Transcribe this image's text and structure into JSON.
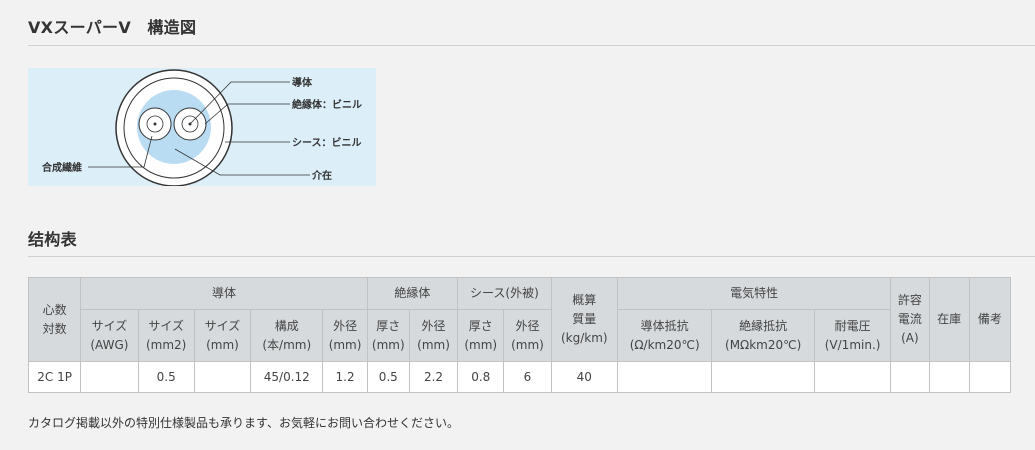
{
  "diagram_section": {
    "title": "VXスーパーV　構造図"
  },
  "diagram": {
    "labels": {
      "conductor": "導体",
      "insulation": "絶縁体：ビニル",
      "sheath": "シース：ビニル",
      "filler": "介在",
      "synthetic_fiber": "合成繊維"
    }
  },
  "table_section": {
    "title": "结构表"
  },
  "table": {
    "headers": {
      "cores": "心数\n対数",
      "conductor": "導体",
      "insulation": "絶縁体",
      "sheath": "シース(外被)",
      "weight": "概算\n質量\n(kg/km)",
      "electrical": "電気特性",
      "current": "許容\n電流\n(A)",
      "stock": "在庫",
      "remarks": "備考",
      "size_awg": "サイズ\n(AWG)",
      "size_mm2": "サイズ\n(mm2)",
      "size_mm": "サイズ\n(mm)",
      "composition": "構成\n(本/mm)",
      "cond_od": "外径\n(mm)",
      "ins_thickness": "厚さ\n(mm)",
      "ins_od": "外径\n(mm)",
      "sheath_thickness": "厚さ\n(mm)",
      "sheath_od": "外径\n(mm)",
      "cond_resistance": "導体抵抗\n(Ω/km20℃)",
      "ins_resistance": "絶縁抵抗\n(MΩkm20℃)",
      "withstand_voltage": "耐電圧\n(V/1min.)"
    },
    "rows": [
      {
        "cores": "2C 1P",
        "size_awg": "",
        "size_mm2": "0.5",
        "size_mm": "",
        "composition": "45/0.12",
        "cond_od": "1.2",
        "ins_thickness": "0.5",
        "ins_od": "2.2",
        "sheath_thickness": "0.8",
        "sheath_od": "6",
        "weight": "40",
        "cond_resistance": "",
        "ins_resistance": "",
        "withstand_voltage": "",
        "current": "",
        "stock": "",
        "remarks": ""
      }
    ]
  },
  "footer": {
    "note": "カタログ掲載以外の特別仕様製品も承ります、お気軽にお問い合わせください。"
  },
  "colors": {
    "page_bg": "#f2f2f2",
    "header_bg": "#d6dadd",
    "diagram_bg": "#dceef8",
    "insulation_fill": "#b9dcf3"
  }
}
